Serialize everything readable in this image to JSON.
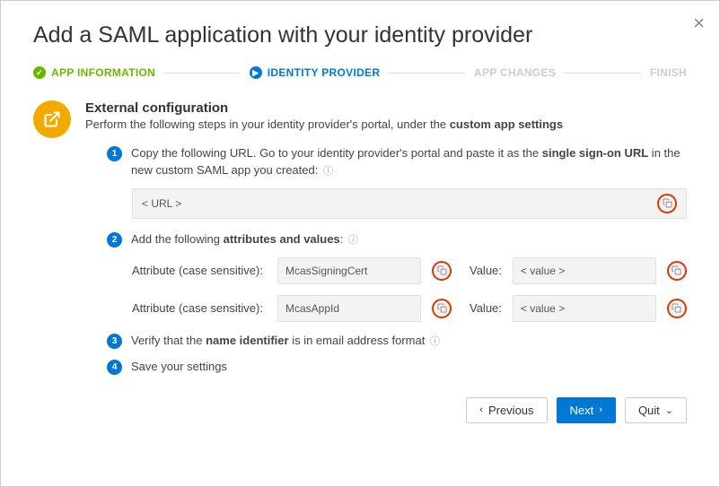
{
  "modal": {
    "title": "Add a SAML application with your identity provider"
  },
  "stepper": {
    "steps": [
      {
        "label": "APP INFORMATION",
        "state": "done"
      },
      {
        "label": "IDENTITY PROVIDER",
        "state": "active"
      },
      {
        "label": "APP CHANGES",
        "state": "upcoming"
      },
      {
        "label": "FINISH",
        "state": "upcoming"
      }
    ]
  },
  "section": {
    "heading": "External configuration",
    "subtext_before": "Perform the following steps in your identity provider's portal, under the ",
    "subtext_bold": "custom app settings"
  },
  "step1": {
    "num": "1",
    "before": "Copy the following URL. Go to your identity provider's portal and paste it as the ",
    "bold": "single sign-on URL",
    "after": " in the new custom SAML app you created:",
    "url_value": "< URL >"
  },
  "step2": {
    "num": "2",
    "before": "Add the following ",
    "bold": "attributes and values",
    "after": ":",
    "rows": [
      {
        "attr_label": "Attribute (case sensitive):",
        "attr_value": "McasSigningCert",
        "val_label": "Value:",
        "val_value": "< value >"
      },
      {
        "attr_label": "Attribute (case sensitive):",
        "attr_value": "McasAppId",
        "val_label": "Value:",
        "val_value": "< value >"
      }
    ]
  },
  "step3": {
    "num": "3",
    "before": "Verify that the ",
    "bold": "name identifier",
    "after": " is in email address format"
  },
  "step4": {
    "num": "4",
    "text": "Save your settings"
  },
  "footer": {
    "previous": "Previous",
    "next": "Next",
    "quit": "Quit"
  }
}
